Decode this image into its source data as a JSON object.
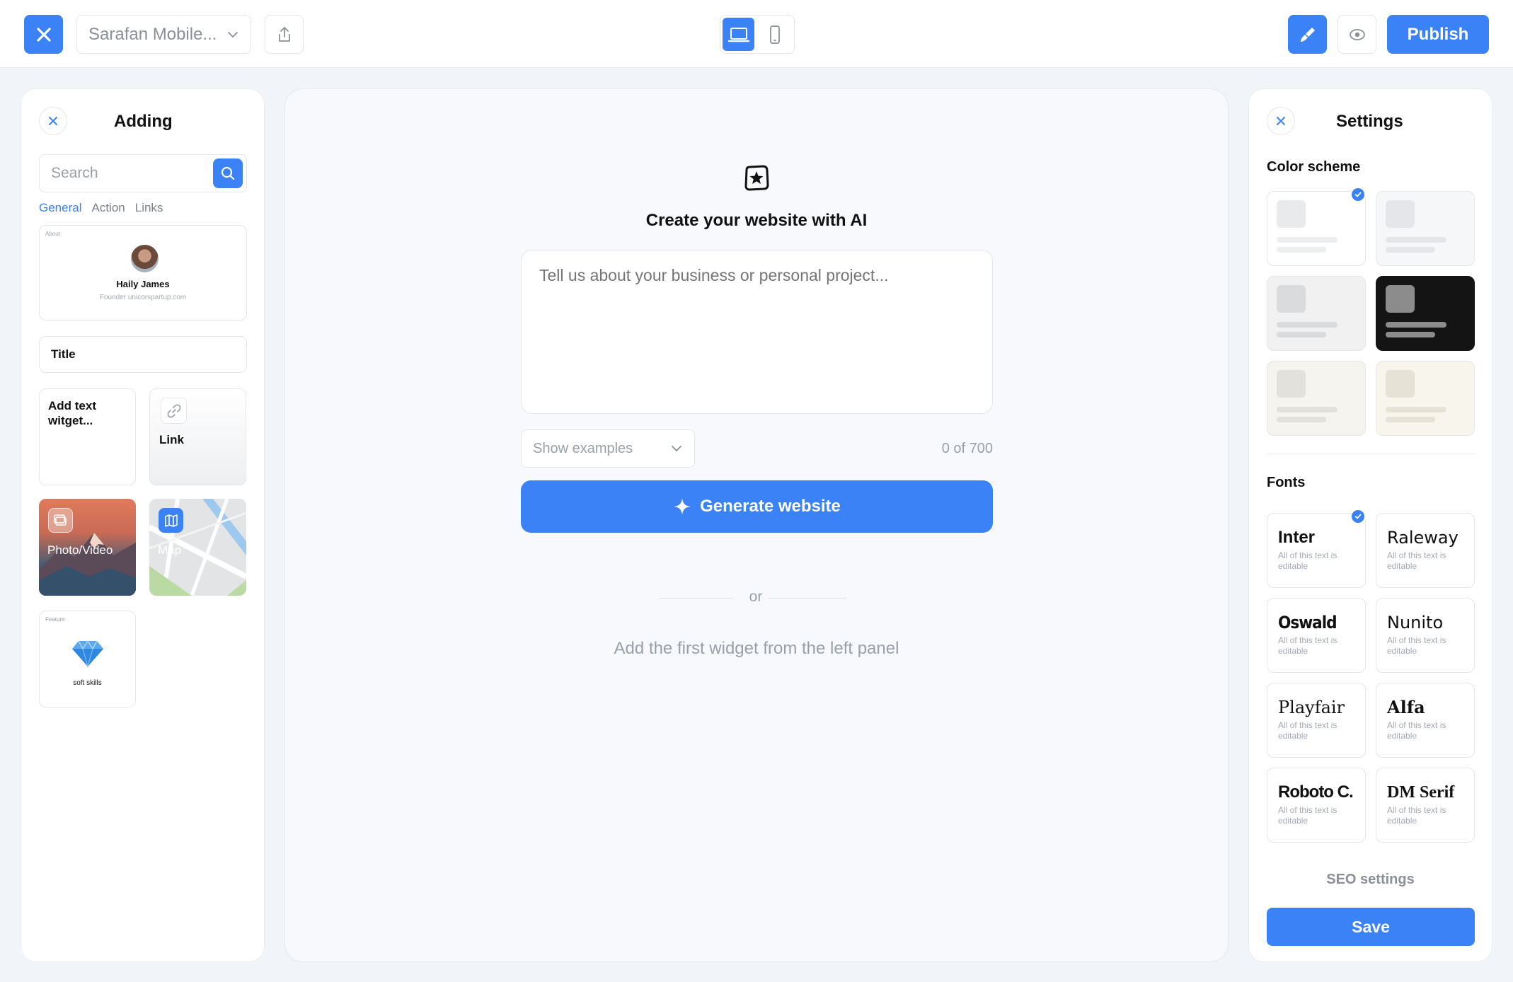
{
  "topbar": {
    "project_name": "Sarafan Mobile...",
    "publish_label": "Publish",
    "icons": [
      "close-icon",
      "chevron-down-icon",
      "share-icon",
      "laptop-icon",
      "mobile-icon",
      "brush-icon",
      "eye-icon"
    ],
    "accent_color": "#3b82f6"
  },
  "left_panel": {
    "title": "Adding",
    "search_placeholder": "Search",
    "tabs": [
      {
        "label": "General",
        "active": true
      },
      {
        "label": "Action",
        "active": false
      },
      {
        "label": "Links",
        "active": false
      }
    ],
    "widgets": {
      "about": {
        "tag": "About",
        "name": "Haily James",
        "subtitle": "Founder unicorspartup.com"
      },
      "title": "Title",
      "text": "Add text witget...",
      "link": "Link",
      "photo": "Photo/Video",
      "map": "Map",
      "feature": {
        "tag": "Feature",
        "label": "soft skills"
      }
    }
  },
  "canvas": {
    "heading": "Create your website with AI",
    "prompt_placeholder": "Tell us about your business or personal project...",
    "examples_label": "Show examples",
    "char_count": "0 of 700",
    "generate_label": "Generate website",
    "or_text": "or",
    "empty_hint": "Add the first widget from the left panel"
  },
  "right_panel": {
    "title": "Settings",
    "color_scheme_label": "Color scheme",
    "color_schemes": [
      {
        "bg": "#ffffff",
        "square": "#e9eaec",
        "line": "#eceef0",
        "selected": true
      },
      {
        "bg": "#f6f7f9",
        "square": "#e4e6e9",
        "line": "#e4e6e9",
        "selected": false
      },
      {
        "bg": "#f1f1f2",
        "square": "#dadbdd",
        "line": "#dadbdd",
        "selected": false
      },
      {
        "bg": "#141414",
        "square": "#8c8c8c",
        "line": "#8c8c8c",
        "selected": false
      },
      {
        "bg": "#f5f4ef",
        "square": "#e2e1db",
        "line": "#e2e1db",
        "selected": false
      },
      {
        "bg": "#f8f6ec",
        "square": "#e6e3d6",
        "line": "#e6e3d6",
        "selected": false
      }
    ],
    "fonts_label": "Fonts",
    "fonts": [
      {
        "name": "Inter",
        "sample": "All of this text is editable",
        "selected": true
      },
      {
        "name": "Raleway",
        "sample": "All of this text is editable",
        "selected": false
      },
      {
        "name": "Oswald",
        "sample": "All of this text is editable",
        "selected": false
      },
      {
        "name": "Nunito",
        "sample": "All of this text is editable",
        "selected": false
      },
      {
        "name": "Playfair",
        "sample": "All of this text is editable",
        "selected": false
      },
      {
        "name": "Alfa",
        "sample": "All of this text is editable",
        "selected": false
      },
      {
        "name": "Roboto C.",
        "sample": "All of this text is editable",
        "selected": false
      },
      {
        "name": "DM Serif",
        "sample": "All of this text is editable",
        "selected": false
      }
    ],
    "seo_label": "SEO settings",
    "save_label": "Save"
  }
}
